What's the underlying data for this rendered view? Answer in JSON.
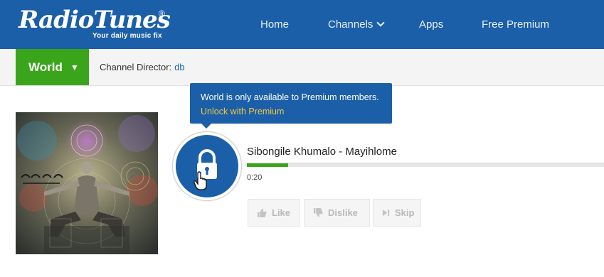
{
  "header": {
    "logo_text": "RadioTunes",
    "logo_registered": "®",
    "logo_tagline": "Your daily music fix",
    "nav": {
      "home": "Home",
      "channels": "Channels",
      "apps": "Apps",
      "free_premium": "Free Premium"
    }
  },
  "channel_bar": {
    "channel_name": "World",
    "channel_caret": "▼",
    "director_label": "Channel Director:",
    "director_name": "db"
  },
  "tooltip": {
    "message": "World is only available to Premium members.",
    "unlock_link": "Unlock with Premium"
  },
  "player": {
    "track_title": "Sibongile Khumalo - Mayihlome",
    "elapsed": "0:20",
    "progress_fraction": 0.115,
    "like_label": "Like",
    "dislike_label": "Dislike",
    "skip_label": "Skip",
    "play_icon": "lock-icon"
  },
  "colors": {
    "brand_blue": "#1b5fa8",
    "accent_green": "#3aa51b",
    "link_yellow": "#f5c542"
  }
}
